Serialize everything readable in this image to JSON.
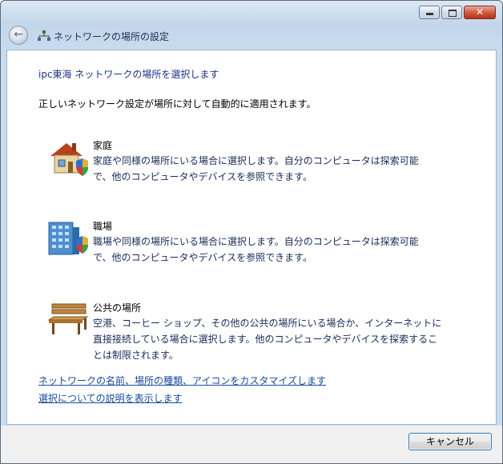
{
  "window": {
    "nav_title": "ネットワークの場所の設定"
  },
  "main": {
    "heading": "ipc東海 ネットワークの場所を選択します",
    "description": "正しいネットワーク設定が場所に対して自動的に適用されます。",
    "options": [
      {
        "title": "家庭",
        "text": "家庭や同様の場所にいる場合に選択します。自分のコンピュータは探索可能で、他のコンピュータやデバイスを参照できます。",
        "icon": "house-icon"
      },
      {
        "title": "職場",
        "text": "職場や同様の場所にいる場合に選択します。自分のコンピュータは探索可能で、他のコンピュータやデバイスを参照できます。",
        "icon": "office-building-icon"
      },
      {
        "title": "公共の場所",
        "text": "空港、コーヒー ショップ、その他の公共の場所にいる場合か、インターネットに直接接続している場合に選択します。他のコンピュータやデバイスを探索することは制限されます。",
        "icon": "park-bench-icon"
      }
    ],
    "links": [
      "ネットワークの名前、場所の種類、アイコンをカスタマイズします",
      "選択についての説明を表示します"
    ]
  },
  "footer": {
    "cancel_label": "キャンセル"
  },
  "colors": {
    "heading": "#1e3287",
    "link": "#1a4a9c",
    "button_border": "#3c7fb1"
  }
}
